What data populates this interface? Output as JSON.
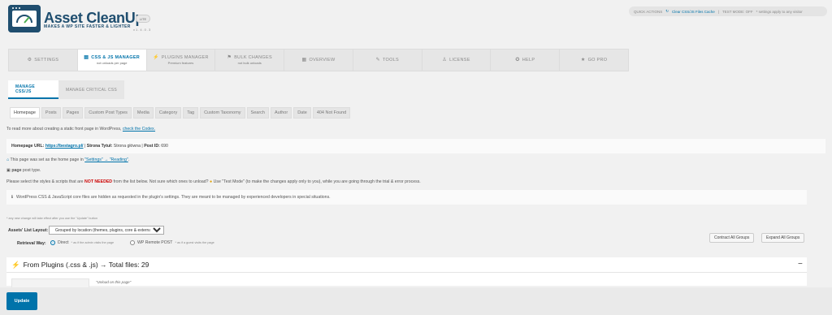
{
  "header": {
    "logo_title": "Asset CleanUp",
    "logo_subtitle": "MAKES A WP SITE FASTER & LIGHTER",
    "version": "v1.4.0.3",
    "edition_badge": "LITE"
  },
  "quick_actions": {
    "label": "QUICK ACTIONS",
    "clear_cache": "Clear CSS/JS Files Cache",
    "test_mode": "TEST MODE: OFF",
    "test_mode_note": "* settings apply to any visitor"
  },
  "main_nav": [
    {
      "id": "settings",
      "label": "SETTINGS",
      "icon": "gear-icon",
      "glyph": "⚙",
      "sub": ""
    },
    {
      "id": "css-js-manager",
      "label": "CSS & JS MANAGER",
      "icon": "code-icon",
      "glyph": "▤",
      "sub": "not unloads per page",
      "active": true
    },
    {
      "id": "plugins-manager",
      "label": "PLUGINS MANAGER",
      "icon": "plug-icon",
      "glyph": "⚡",
      "sub": "Premium features"
    },
    {
      "id": "bulk-changes",
      "label": "BULK CHANGES",
      "icon": "bulk-icon",
      "glyph": "⚑",
      "sub": "not bulk unloads"
    },
    {
      "id": "overview",
      "label": "OVERVIEW",
      "icon": "list-icon",
      "glyph": "▦",
      "sub": ""
    },
    {
      "id": "tools",
      "label": "TOOLS",
      "icon": "wrench-icon",
      "glyph": "✎",
      "sub": ""
    },
    {
      "id": "license",
      "label": "LICENSE",
      "icon": "user-icon",
      "glyph": "♙",
      "sub": ""
    },
    {
      "id": "help",
      "label": "HELP",
      "icon": "help-icon",
      "glyph": "✪",
      "sub": ""
    },
    {
      "id": "go-pro",
      "label": "GO PRO",
      "icon": "star-icon",
      "glyph": "★",
      "sub": ""
    }
  ],
  "sub_tabs": {
    "manage_css_js": "MANAGE CSS/JS",
    "manage_critical_css": "MANAGE CRITICAL CSS"
  },
  "page_tabs": [
    "Homepage",
    "Posts",
    "Pages",
    "Custom Post Types",
    "Media",
    "Category",
    "Tag",
    "Custom Taxonomy",
    "Search",
    "Author",
    "Date",
    "404 Not Found"
  ],
  "content": {
    "read_more_text": "To read more about creating a static front page in WordPress,",
    "read_more_link": "check the Codex.",
    "homepage_url_label": "Homepage URL:",
    "homepage_url": "https://bestagro.pl/",
    "page_title_label": "Strona Tytuł:",
    "page_title": "Strona główna",
    "post_id_label": "Post ID:",
    "post_id": "690",
    "home_set_text": "This page was set as the home page in",
    "settings_reading": "\"Settings\" → \"Reading\"",
    "post_type_badge": "page",
    "post_type_text": "post type.",
    "select_styles_pre": "Please select the styles & scripts that are",
    "not_needed": "NOT NEEDED",
    "select_styles_post": "from the list below. Not sure which ones to unload?",
    "test_mode_hint": "Use \"Test Mode\" (to make the changes apply only to you), while you are going through the trial & error process.",
    "core_files_notice": "WordPress CSS & JavaScript core files are hidden as requested in the plugin's settings. They are meant to be managed by experienced developers in special situations.",
    "change_note": "* any new change will take effect after you use the \"Update\" button",
    "list_layout_label": "Assets' List Layout:",
    "list_layout_value": "Grouped by location (themes, plugins, core & external)",
    "retrieval_label": "Retrieval Way:",
    "retrieval_direct": "Direct",
    "retrieval_direct_note": "* as if the admin visits the page",
    "retrieval_remote": "WP Remote POST",
    "retrieval_remote_note": "* as if a guest visits the page",
    "contract_all": "Contract All Groups",
    "expand_all": "Expand All Groups",
    "group_title": "From Plugins (.css & .js) → Total files: 29",
    "unload_note": "\"Unload on this page\"",
    "update_button": "Update"
  },
  "colors": {
    "accent": "#0073aa",
    "brand": "#1f4e6f",
    "danger": "#cc0000"
  }
}
